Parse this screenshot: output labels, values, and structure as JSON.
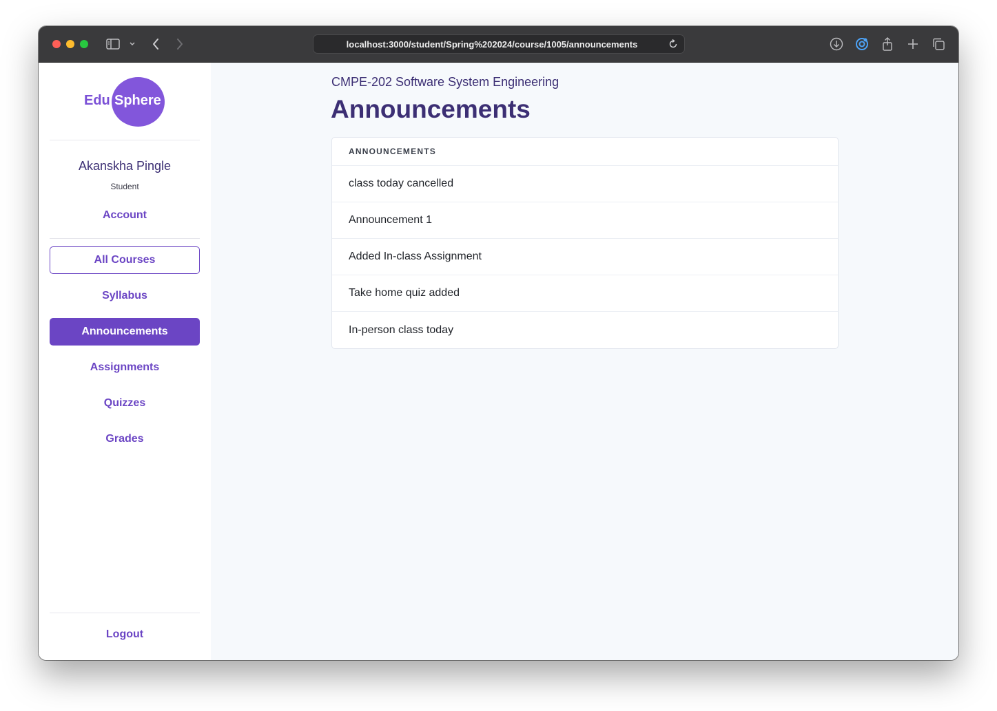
{
  "browser": {
    "url": "localhost:3000/student/Spring%202024/course/1005/announcements",
    "icons": [
      "sidebar-icon",
      "chevron-down-icon",
      "back-icon",
      "forward-icon",
      "reload-icon",
      "download-icon",
      "extension-icon",
      "share-icon",
      "new-tab-icon",
      "tabs-overview-icon"
    ]
  },
  "sidebar": {
    "logo": {
      "left": "Edu",
      "right": "Sphere"
    },
    "user": {
      "name": "Akanskha Pingle",
      "role": "Student"
    },
    "account_label": "Account",
    "nav": [
      {
        "label": "All Courses",
        "state": "outlined"
      },
      {
        "label": "Syllabus",
        "state": "normal"
      },
      {
        "label": "Announcements",
        "state": "active"
      },
      {
        "label": "Assignments",
        "state": "normal"
      },
      {
        "label": "Quizzes",
        "state": "normal"
      },
      {
        "label": "Grades",
        "state": "normal"
      }
    ],
    "logout_label": "Logout"
  },
  "main": {
    "course_title": "CMPE-202 Software System Engineering",
    "page_title": "Announcements",
    "card": {
      "header": "ANNOUNCEMENTS",
      "items": [
        "class today cancelled",
        "Announcement 1",
        "Added In-class Assignment",
        "Take home quiz added",
        "In-person class today"
      ]
    }
  },
  "colors": {
    "accent": "#6b45c4",
    "heading": "#3c2f74",
    "logo_circle": "#8256db",
    "main_bg": "#f6f9fc"
  }
}
